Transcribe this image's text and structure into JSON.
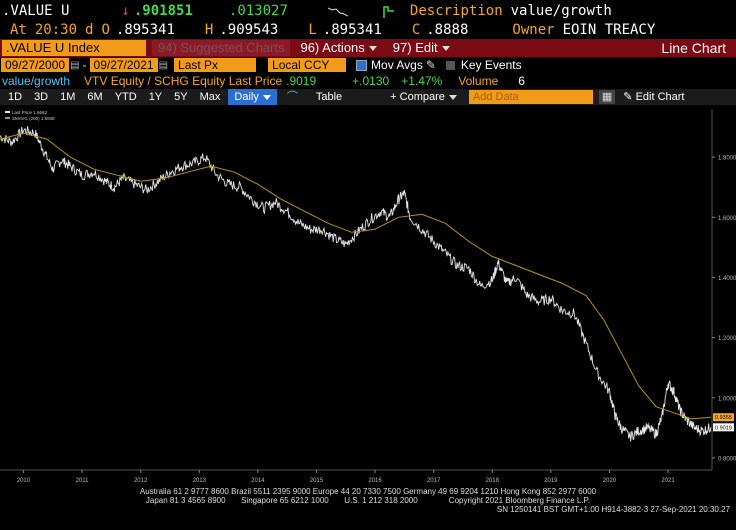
{
  "quote": {
    "ticker": ".VALUE U",
    "arrow": "↓",
    "last": ".901851",
    "change": ".013027",
    "desc_label": "Description",
    "desc_value": "value/growth",
    "at_label": "At",
    "time": "20:30",
    "d_label": "d",
    "open_label": "O",
    "open": ".895341",
    "high_label": "H",
    "high": ".909543",
    "low_label": "L",
    "low": ".895341",
    "close_label": "C",
    "close": ".8888",
    "owner_label": "Owner",
    "owner": "EOIN TREACY"
  },
  "menubar": {
    "security": ".VALUE U Index",
    "suggested": "94) Suggested Charts",
    "actions": "96) Actions",
    "edit": "97) Edit",
    "chart_type": "Line Chart"
  },
  "range": {
    "start": "09/27/2000",
    "end": "09/27/2021",
    "field": "Last Px",
    "currency": "Local CCY",
    "mov_avgs": "Mov Avgs",
    "key_events": "Key Events"
  },
  "legend": {
    "name": "value/growth",
    "formula": "VTV Equity / SCHG Equity Last Price",
    "price": ".9019",
    "chg": "+.0130",
    "pct": "+1.47%",
    "volume_label": "Volume",
    "volume": "6"
  },
  "toolbar": {
    "periods": [
      "1D",
      "3D",
      "1M",
      "6M",
      "YTD",
      "1Y",
      "5Y",
      "Max"
    ],
    "freq": "Daily",
    "table": "Table",
    "compare": "+ Compare",
    "add_data": "Add Data",
    "edit_chart": "Edit Chart"
  },
  "colors": {
    "amber": "#f5a623",
    "price_line": "#e6e6e6",
    "sma_line": "#b8960a",
    "header_bar": "#7a0a14"
  },
  "chart_data": {
    "type": "line",
    "inner_legend": [
      "Last Price  1.6662",
      "SMAVG (200)  1.5938"
    ],
    "x_ticks": [
      "2010",
      "2011",
      "2012",
      "2013",
      "2014",
      "2015",
      "2016",
      "2017",
      "2018",
      "2019",
      "2020",
      "2021"
    ],
    "y_ticks": [
      "0.8000",
      "1.0000",
      "1.2000",
      "1.4000",
      "1.6000",
      "1.8000"
    ],
    "ylim": [
      0.76,
      1.96
    ],
    "xlim": [
      2009.6,
      2021.75
    ],
    "price_tag": "0.9019",
    "sma_tag": "0.9355",
    "series": [
      {
        "name": "Last Price",
        "x": [
          2009.6,
          2009.8,
          2010.0,
          2010.2,
          2010.35,
          2010.5,
          2010.65,
          2010.8,
          2011.0,
          2011.2,
          2011.4,
          2011.55,
          2011.7,
          2011.9,
          2012.1,
          2012.3,
          2012.5,
          2012.7,
          2012.9,
          2013.1,
          2013.3,
          2013.5,
          2013.7,
          2013.9,
          2014.1,
          2014.3,
          2014.5,
          2014.7,
          2014.9,
          2015.1,
          2015.3,
          2015.5,
          2015.7,
          2015.9,
          2016.1,
          2016.25,
          2016.4,
          2016.5,
          2016.6,
          2016.8,
          2017.0,
          2017.2,
          2017.4,
          2017.6,
          2017.8,
          2018.0,
          2018.1,
          2018.25,
          2018.4,
          2018.6,
          2018.8,
          2019.0,
          2019.2,
          2019.4,
          2019.6,
          2019.8,
          2020.0,
          2020.1,
          2020.2,
          2020.35,
          2020.5,
          2020.65,
          2020.8,
          2020.9,
          2021.0,
          2021.1,
          2021.2,
          2021.3,
          2021.45,
          2021.6,
          2021.73
        ],
        "values": [
          1.87,
          1.85,
          1.89,
          1.88,
          1.82,
          1.76,
          1.79,
          1.77,
          1.74,
          1.75,
          1.72,
          1.7,
          1.73,
          1.71,
          1.69,
          1.72,
          1.75,
          1.77,
          1.78,
          1.8,
          1.74,
          1.71,
          1.7,
          1.66,
          1.63,
          1.65,
          1.62,
          1.58,
          1.56,
          1.56,
          1.53,
          1.51,
          1.55,
          1.59,
          1.62,
          1.6,
          1.66,
          1.68,
          1.6,
          1.56,
          1.52,
          1.48,
          1.44,
          1.43,
          1.37,
          1.39,
          1.45,
          1.38,
          1.4,
          1.34,
          1.32,
          1.33,
          1.29,
          1.28,
          1.18,
          1.08,
          1.02,
          0.94,
          0.9,
          0.87,
          0.89,
          0.9,
          0.88,
          0.94,
          1.05,
          1.02,
          0.96,
          0.93,
          0.9,
          0.89,
          0.9019
        ]
      },
      {
        "name": "SMAVG (200)",
        "x": [
          2009.6,
          2010.0,
          2010.4,
          2010.8,
          2011.2,
          2011.6,
          2012.0,
          2012.4,
          2012.8,
          2013.2,
          2013.6,
          2014.0,
          2014.4,
          2014.8,
          2015.2,
          2015.6,
          2016.0,
          2016.4,
          2016.8,
          2017.2,
          2017.6,
          2018.0,
          2018.4,
          2018.8,
          2019.2,
          2019.6,
          2019.9,
          2020.2,
          2020.5,
          2020.8,
          2021.1,
          2021.4,
          2021.73
        ],
        "values": [
          1.86,
          1.88,
          1.86,
          1.8,
          1.76,
          1.74,
          1.72,
          1.73,
          1.75,
          1.77,
          1.75,
          1.71,
          1.66,
          1.62,
          1.58,
          1.55,
          1.56,
          1.6,
          1.61,
          1.58,
          1.52,
          1.47,
          1.44,
          1.41,
          1.38,
          1.34,
          1.26,
          1.15,
          1.04,
          0.97,
          0.95,
          0.93,
          0.9355
        ]
      }
    ]
  },
  "footer": {
    "line1": "Australia 61 2 9777 8600 Brazil 5511 2395 9000 Europe 44 20 7330 7500 Germany 49 69 9204 1210 Hong Kong 852 2977 6000",
    "line2": "Japan 81 3 4565 8900       Singapore 65 6212 1000       U.S. 1 212 318 2000              Copyright 2021 Bloomberg Finance L.P.",
    "line3": "SN 1250141 BST  GMT+1:00 H914-3882-3 27-Sep-2021 20:30:27"
  }
}
